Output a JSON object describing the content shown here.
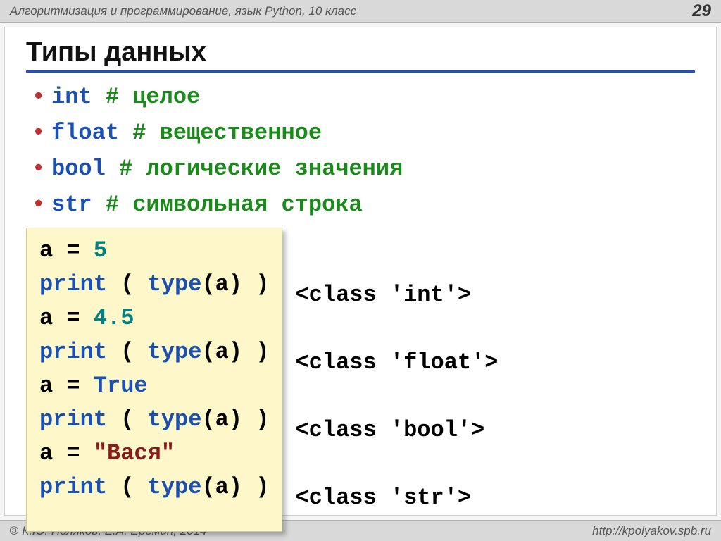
{
  "header": {
    "subject": "Алгоритмизация и программирование, язык Python, 10 класс",
    "page": "29"
  },
  "title": "Типы данных",
  "bullets": [
    {
      "kw": "int",
      "pad": "          ",
      "cmt": "# целое"
    },
    {
      "kw": "float",
      "pad": "  ",
      "cmt": "# вещественное"
    },
    {
      "kw": "bool",
      "pad": "   ",
      "cmt": "# логические значения"
    },
    {
      "kw": "str",
      "pad": "    ",
      "cmt": "# символьная строка"
    }
  ],
  "code": {
    "l1a": "a = ",
    "l1b": "5",
    "l2a": "print",
    "l2b": " ( ",
    "l2c": "type",
    "l2d": "(a) )",
    "l3a": "a = ",
    "l3b": "4.5",
    "l4a": "print",
    "l4b": " ( ",
    "l4c": "type",
    "l4d": "(a) )",
    "l5a": "a = ",
    "l5b": "True",
    "l6a": "print",
    "l6b": " ( ",
    "l6c": "type",
    "l6d": "(a) )",
    "l7a": "a = ",
    "l7b": "\"Вася\"",
    "l8a": "print",
    "l8b": " ( ",
    "l8c": "type",
    "l8d": "(a) )"
  },
  "outputs": {
    "o1": "<class 'int'>",
    "o2": "<class 'float'>",
    "o3": "<class 'bool'>",
    "o4": "<class 'str'>"
  },
  "footer": {
    "authors": " К.Ю. Поляков, Е.А. Ерёмин, 2014",
    "site": "http://kpolyakov.spb.ru"
  }
}
